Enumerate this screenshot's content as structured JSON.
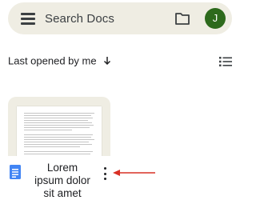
{
  "search": {
    "placeholder": "Search Docs"
  },
  "account": {
    "avatar_initial": "J",
    "avatar_color": "#2d6a1c"
  },
  "sort": {
    "label": "Last opened by me",
    "direction": "descending"
  },
  "documents": [
    {
      "title": "Lorem ipsum dolor sit amet",
      "type_icon": "docs-icon"
    }
  ],
  "icons": {
    "menu": "menu-icon",
    "folder": "folder-icon",
    "list_view": "list-view-icon",
    "more": "more-vert-icon",
    "annotation": "arrow-left-icon"
  },
  "colors": {
    "search_bar_bg": "#efede3",
    "docs_blue": "#4285f4",
    "annotation_red": "#d93025"
  }
}
